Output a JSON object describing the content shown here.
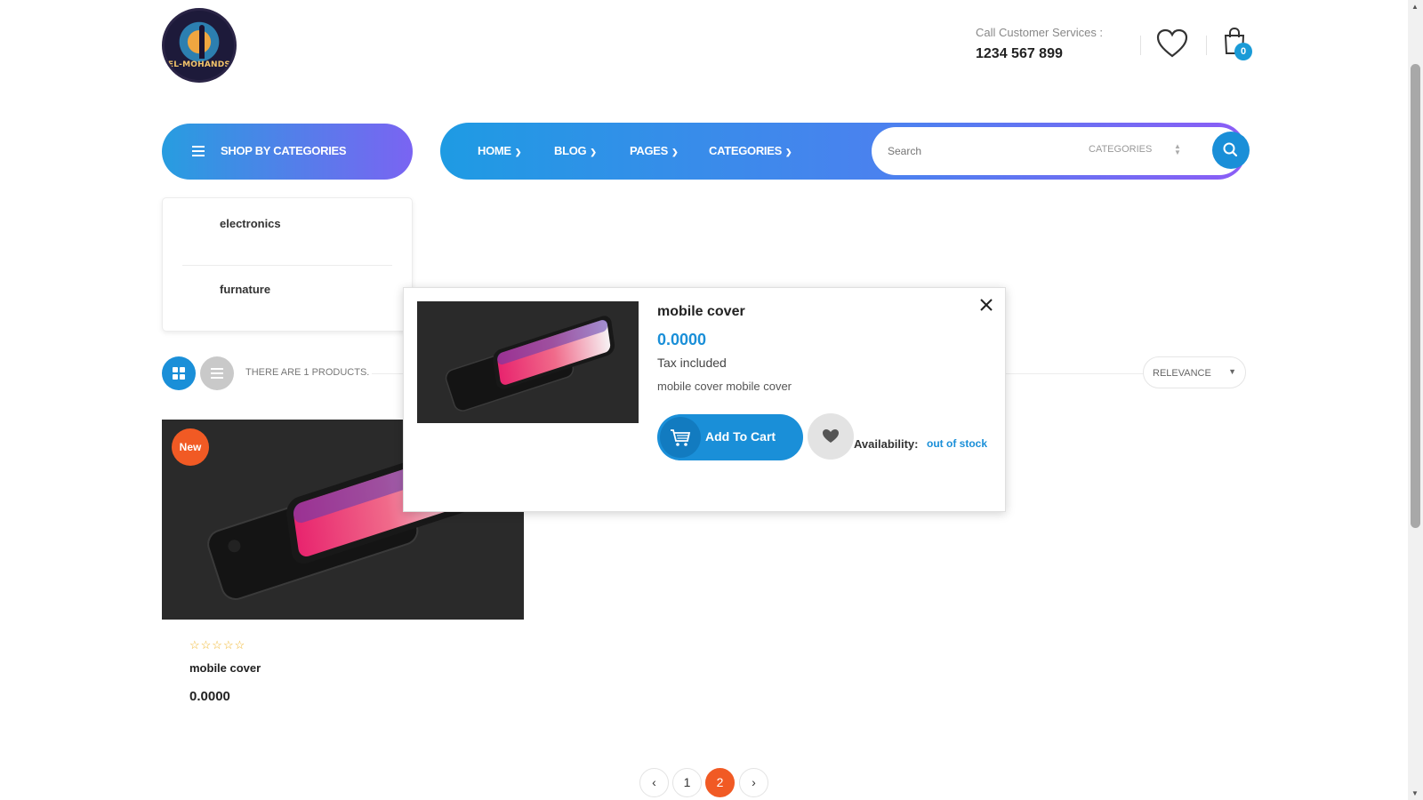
{
  "header": {
    "logo_text": "EL-MOHANDS",
    "call_label": "Call Customer Services :",
    "call_number": "1234 567 899",
    "cart_count": "0",
    "wishlist_icon": "heart-outline-icon",
    "cart_icon": "shopping-bag-icon"
  },
  "nav": {
    "categories_button": "SHOP BY CATEGORIES",
    "items": [
      {
        "label": "HOME"
      },
      {
        "label": "BLOG"
      },
      {
        "label": "PAGES"
      },
      {
        "label": "CATEGORIES"
      }
    ],
    "search": {
      "placeholder": "Search",
      "category_select": "CATEGORIES"
    }
  },
  "category_menu": {
    "items": [
      {
        "label": "electronics"
      },
      {
        "label": "furnature"
      }
    ]
  },
  "toolbar": {
    "count_text": "THERE ARE 1 PRODUCTS.",
    "sort_label": "RELEVANCE"
  },
  "product": {
    "badge": "New",
    "rating_stars": "☆☆☆☆☆",
    "name": "mobile cover",
    "price": "0.0000"
  },
  "pagination": {
    "pages": [
      "1",
      "2"
    ],
    "active": "2"
  },
  "quick_view": {
    "title": "mobile cover",
    "price": "0.0000",
    "tax": "Tax included",
    "description": "mobile cover mobile cover",
    "add_to_cart": "Add To Cart",
    "availability_label": "Availability:",
    "availability_value": "out of stock"
  },
  "colors": {
    "accent_blue": "#1a8fd8",
    "accent_purple": "#8c5df6",
    "badge_orange": "#f15a24",
    "star_yellow": "#f0b428"
  }
}
